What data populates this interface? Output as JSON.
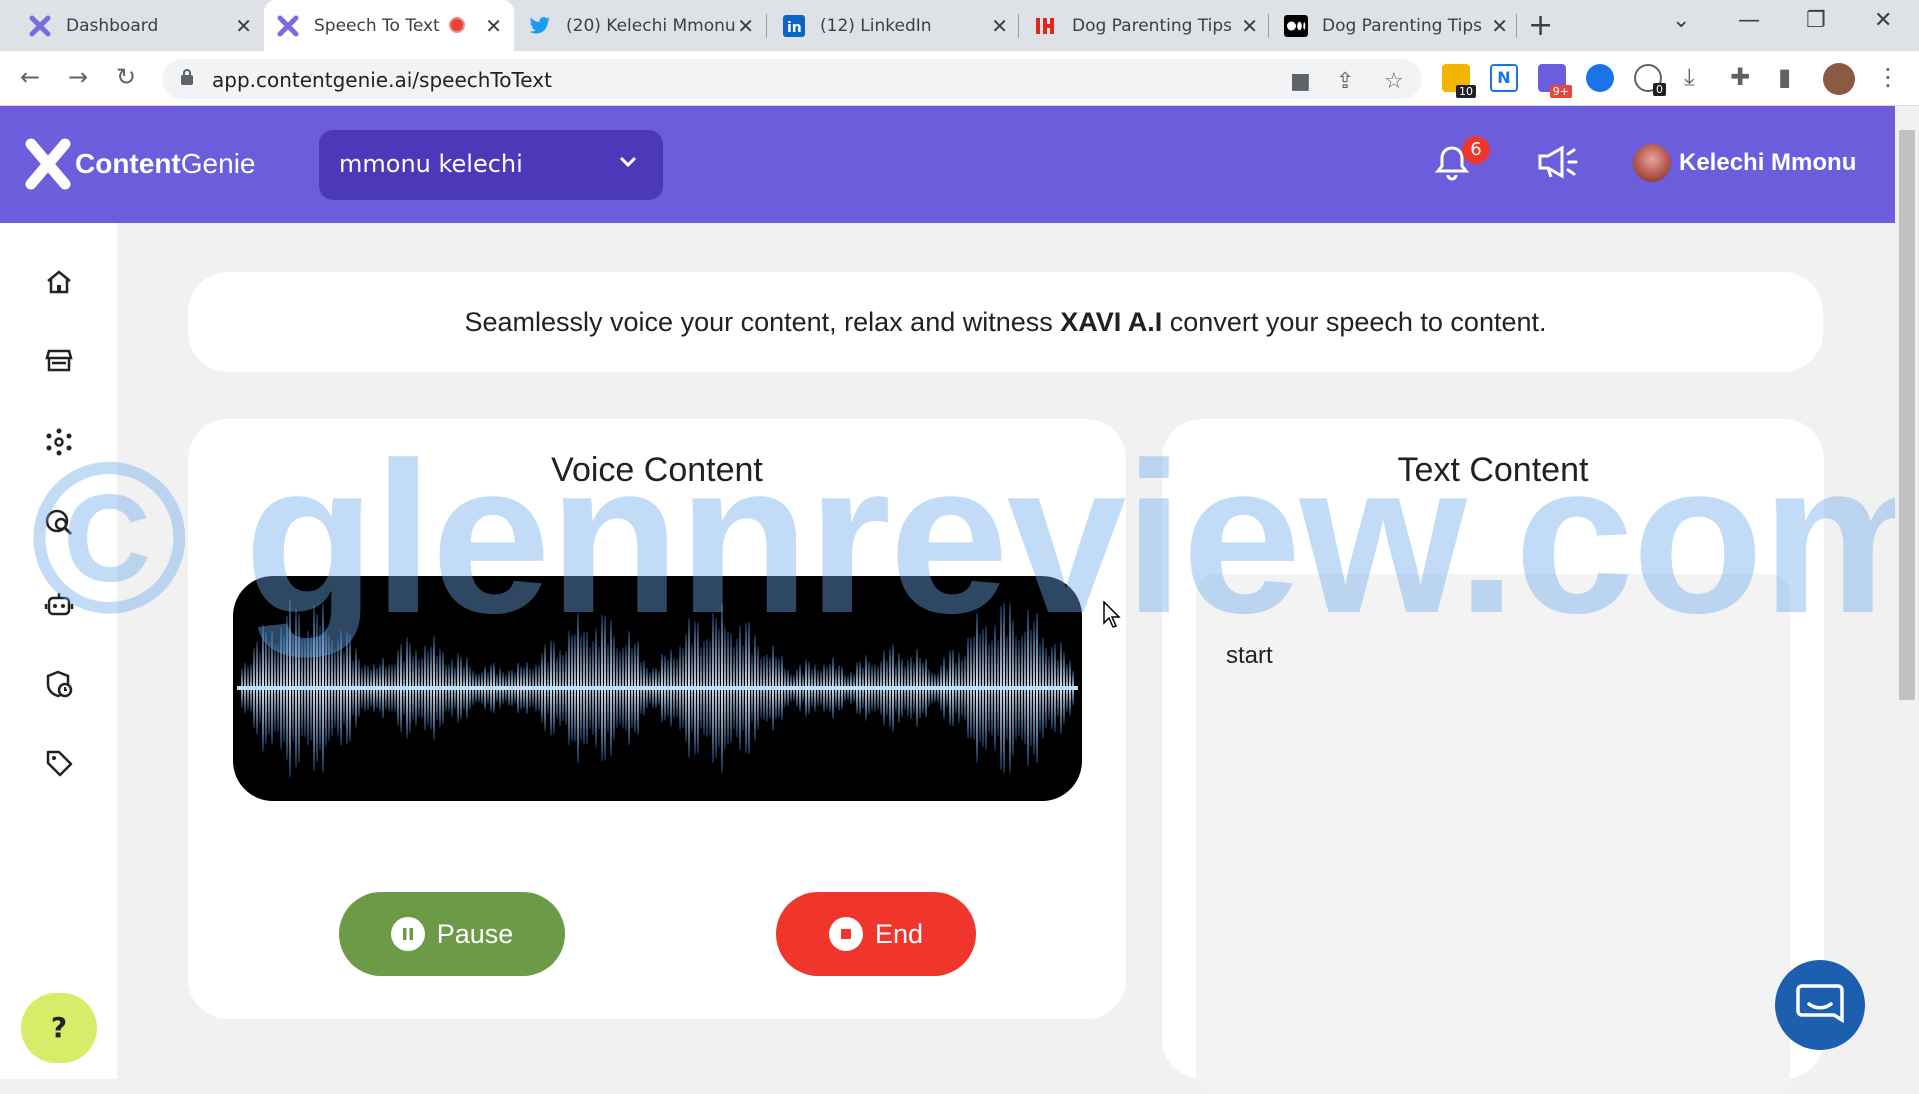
{
  "browser": {
    "tabs": [
      {
        "label": "Dashboard",
        "active": false
      },
      {
        "label": "Speech To Text",
        "active": true
      },
      {
        "label": "(20) Kelechi Mmonu",
        "active": false
      },
      {
        "label": "(12) LinkedIn",
        "active": false
      },
      {
        "label": "Dog Parenting Tips",
        "active": false
      },
      {
        "label": "Dog Parenting Tips",
        "active": false
      }
    ],
    "url": "app.contentgenie.ai/speechToText",
    "extension_badges": [
      "10",
      "9+",
      "0"
    ]
  },
  "header": {
    "logo_bold": "Content",
    "logo_light": "Genie",
    "workspace": "mmonu kelechi",
    "notification_count": "6",
    "user_name": "Kelechi Mmonu",
    "colors": {
      "header_bg": "#6b5ddc",
      "workspace_bg": "#4c38b8"
    }
  },
  "sidebar": {
    "items": [
      "home-icon",
      "store-icon",
      "network-icon",
      "search-globe-icon",
      "robot-icon",
      "shield-clock-icon",
      "tag-icon"
    ]
  },
  "banner": {
    "text_before": "Seamlessly voice your content, relax and witness ",
    "brand": "XAVI A.I",
    "text_after": " convert your speech to content."
  },
  "voice": {
    "title": "Voice Content",
    "pause_label": "Pause",
    "end_label": "End",
    "colors": {
      "pause": "#6c9a46",
      "end": "#f0362c"
    }
  },
  "text_content": {
    "title": "Text Content",
    "body": "start"
  },
  "help_label": "?",
  "watermark": "© glennreview.com"
}
